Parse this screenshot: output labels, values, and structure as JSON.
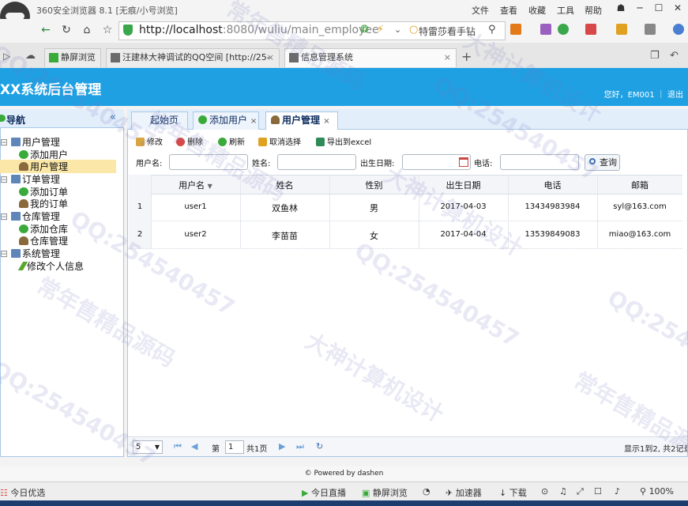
{
  "browser": {
    "window_title": "360安全浏览器 8.1 [无痕/小号浏览]",
    "menu": [
      "文件",
      "查看",
      "收藏",
      "工具",
      "帮助"
    ],
    "url_host": "http://localhost",
    "url_rest": ":8080/wuliu/main_employee",
    "search_text": "特雷莎看手钻",
    "tabs": [
      {
        "label": "静屏浏览"
      },
      {
        "label": "汪建林大神调试的QQ空间 [http://25-",
        "close": "×"
      },
      {
        "label": "信息管理系统",
        "close": "×"
      }
    ],
    "new_tab": "+"
  },
  "app": {
    "title": "XX系统后台管理",
    "greeting": "您好，EM001 ｜ 退出"
  },
  "nav": {
    "title": "导航",
    "collapse": "«",
    "items": [
      {
        "label": "用户管理"
      },
      {
        "label": "添加用户"
      },
      {
        "label": "用户管理"
      },
      {
        "label": "订单管理"
      },
      {
        "label": "添加订单"
      },
      {
        "label": "我的订单"
      },
      {
        "label": "仓库管理"
      },
      {
        "label": "添加仓库"
      },
      {
        "label": "仓库管理"
      },
      {
        "label": "系统管理"
      },
      {
        "label": "修改个人信息"
      }
    ]
  },
  "content_tabs": [
    {
      "label": "起始页"
    },
    {
      "label": "添加用户",
      "close": "×"
    },
    {
      "label": "用户管理",
      "close": "×"
    }
  ],
  "toolbar": {
    "edit": "修改",
    "delete": "删除",
    "refresh": "刷新",
    "unselect": "取消选择",
    "export": "导出到excel"
  },
  "filters": {
    "username_label": "用户名:",
    "name_label": "姓名:",
    "birth_label": "出生日期:",
    "phone_label": "电话:",
    "query_button": "查询"
  },
  "grid": {
    "columns": [
      "用户名",
      "姓名",
      "性别",
      "出生日期",
      "电话",
      "邮箱"
    ],
    "rows": [
      {
        "num": "1",
        "username": "user1",
        "name": "双鱼林",
        "gender": "男",
        "birth": "2017-04-03",
        "phone": "13434983984",
        "email": "syl@163.com"
      },
      {
        "num": "2",
        "username": "user2",
        "name": "李苗苗",
        "gender": "女",
        "birth": "2017-04-04",
        "phone": "13539849083",
        "email": "miao@163.com"
      }
    ]
  },
  "pager": {
    "page_size": "5",
    "page_prefix": "第",
    "page_number": "1",
    "page_suffix": "共1页",
    "summary": "显示1到2, 共2记录"
  },
  "footer": "© Powered by dashen",
  "statusbar": {
    "left": "今日优选",
    "live": "今日直播",
    "view": "静屏浏览",
    "accelerator": "加速器",
    "download": "下载",
    "zoom": "100%"
  },
  "watermarks": [
    "常年售精品源码",
    "QQ:254540457",
    "大神计算机设计"
  ]
}
